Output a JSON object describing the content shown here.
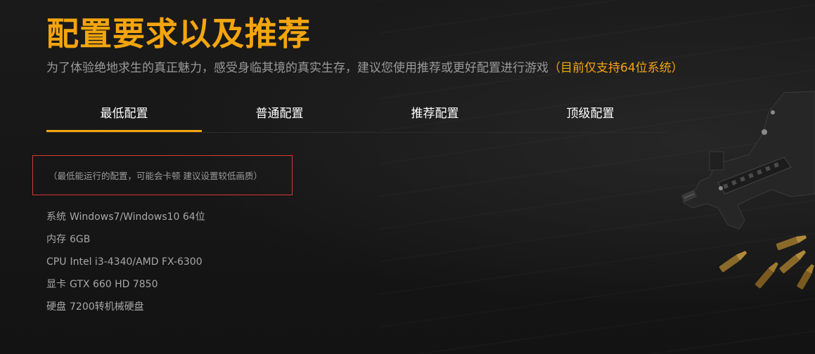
{
  "header": {
    "title": "配置要求以及推荐",
    "subtitle": "为了体验绝地求生的真正魅力，感受身临其境的真实生存，建议您使用推荐或更好配置进行游戏",
    "subtitle_highlight": "（目前仅支持64位系统）"
  },
  "tabs": [
    {
      "label": "最低配置",
      "active": true
    },
    {
      "label": "普通配置",
      "active": false
    },
    {
      "label": "推荐配置",
      "active": false
    },
    {
      "label": "顶级配置",
      "active": false
    }
  ],
  "note": "（最低能运行的配置，可能会卡顿 建议设置较低画质）",
  "specs": [
    {
      "label": "系统",
      "value": "Windows7/Windows10 64位"
    },
    {
      "label": "内存",
      "value": "6GB"
    },
    {
      "label": "CPU",
      "value": "Intel i3-4340/AMD FX-6300"
    },
    {
      "label": "显卡",
      "value": "GTX 660 HD 7850"
    },
    {
      "label": "硬盘",
      "value": "7200转机械硬盘"
    }
  ],
  "colors": {
    "accent": "#f3a50f",
    "note_border": "#d23a32",
    "background": "#141414"
  },
  "decoration": {
    "image": "rifle-and-bullets-image"
  }
}
